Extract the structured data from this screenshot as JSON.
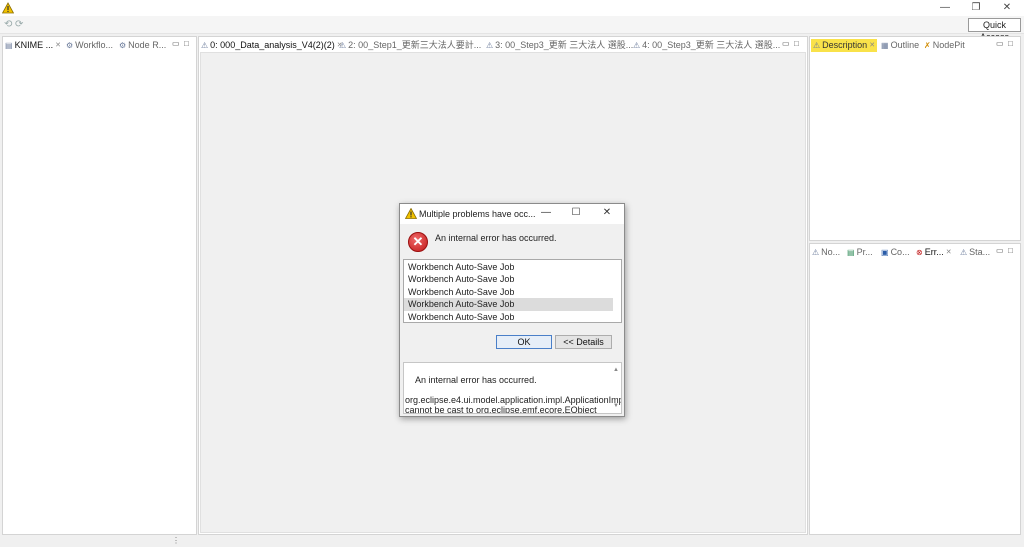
{
  "window": {
    "app_icon": "warning-triangle-icon",
    "minimize_glyph": "—",
    "restore_glyph": "❐",
    "close_glyph": "✕"
  },
  "toolbar": {
    "undo_glyph": "⟲",
    "redo_glyph": "⟳",
    "quick_access": "Quick Access"
  },
  "left_panel": {
    "tabs": [
      {
        "label": "KNIME ...",
        "icon": "folder-icon"
      },
      {
        "label": "Workflo...",
        "icon": "workflow-icon"
      },
      {
        "label": "Node R...",
        "icon": "node-repository-icon"
      }
    ]
  },
  "editor": {
    "tabs": [
      {
        "label": "0: 000_Data_analysis_V4(2)(2)"
      },
      {
        "label": "2: 00_Step1_更新三大法人要計..."
      },
      {
        "label": "3: 00_Step3_更新 三大法人 選股..."
      },
      {
        "label": "4: 00_Step3_更新 三大法人 選股..."
      }
    ]
  },
  "right_top_panel": {
    "tabs": [
      {
        "label": "Description",
        "icon": "description-icon"
      },
      {
        "label": "Outline",
        "icon": "outline-icon"
      },
      {
        "label": "NodePit",
        "icon": "nodepit-icon"
      }
    ]
  },
  "right_bottom_panel": {
    "tabs": [
      {
        "label": "No..."
      },
      {
        "label": "Pr..."
      },
      {
        "label": "Co..."
      },
      {
        "label": "Err..."
      },
      {
        "label": "Sta..."
      }
    ]
  },
  "panel_controls": {
    "minimize": "▭",
    "maximize": "□"
  },
  "dialog": {
    "title": "Multiple problems have occ...",
    "message": "An internal error has occurred.",
    "error_glyph": "✕",
    "problems": [
      "Workbench Auto-Save Job",
      "Workbench Auto-Save Job",
      "Workbench Auto-Save Job",
      "Workbench Auto-Save Job",
      "Workbench Auto-Save Job"
    ],
    "ok_label": "OK",
    "details_label": "<< Details",
    "details_text": "An internal error has occurred.\n  org.eclipse.e4.ui.model.application.impl.ApplicationImpl cannot be cast to org.eclipse.emf.ecore.EObject",
    "minimize_glyph": "—",
    "maximize_glyph": "☐",
    "close_glyph": "✕"
  },
  "colors": {
    "highlight_tab": "#f9e24a",
    "error_red": "#c01818",
    "warning_yellow": "#f2c200"
  }
}
